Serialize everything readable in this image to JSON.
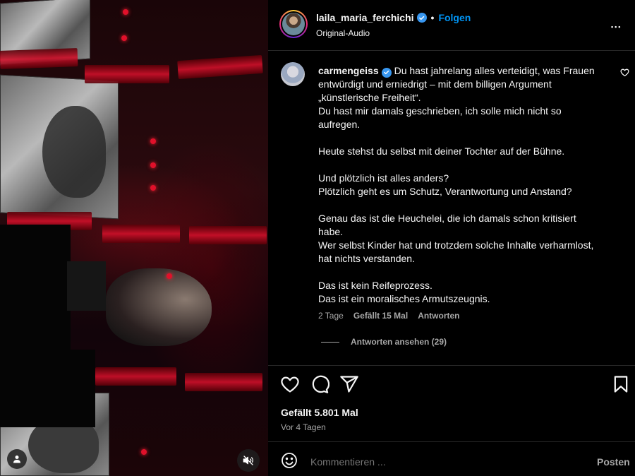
{
  "post": {
    "username": "laila_maria_ferchichi",
    "separator": "•",
    "follow_label": "Folgen",
    "audio": "Original-Audio",
    "more_label": "•••"
  },
  "comment": {
    "username": "carmengeiss",
    "lines": [
      "Du hast jahrelang alles verteidigt, was Frauen",
      "entwürdigt und erniedrigt – mit dem billigen Argument",
      "„künstlerische Freiheit“.",
      "Du hast mir damals geschrieben, ich solle mich nicht so",
      "aufregen.",
      "",
      "Heute stehst du selbst mit deiner Tochter auf der Bühne.",
      "",
      "Und plötzlich ist alles anders?",
      "Plötzlich geht es um Schutz, Verantwortung und Anstand?",
      "",
      "Genau das ist die Heuchelei, die ich damals schon kritisiert",
      "habe.",
      "Wer selbst Kinder hat und trotzdem solche Inhalte verharmlost,",
      "hat nichts verstanden.",
      "",
      "Das ist kein Reifeprozess.",
      "Das ist ein moralisches Armutszeugnis."
    ],
    "age": "2 Tage",
    "likes": "Gefällt 15 Mal",
    "reply_label": "Antworten",
    "view_replies": "Antworten ansehen (29)"
  },
  "actions": {
    "likes": "Gefällt 5.801 Mal",
    "posted": "Vor 4 Tagen"
  },
  "composer": {
    "placeholder": "Kommentieren ...",
    "post_label": "Posten"
  },
  "colors": {
    "accent": "#0095f6",
    "verified": "#3897f0",
    "muted": "#a8a8a8",
    "background": "#000000"
  },
  "icons": {
    "verified": "verified-badge-icon",
    "like": "heart-icon",
    "comment": "comment-bubble-icon",
    "share": "paper-plane-icon",
    "save": "bookmark-icon",
    "emoji": "smiley-icon",
    "mute": "speaker-muted-icon",
    "tagged": "person-icon"
  }
}
